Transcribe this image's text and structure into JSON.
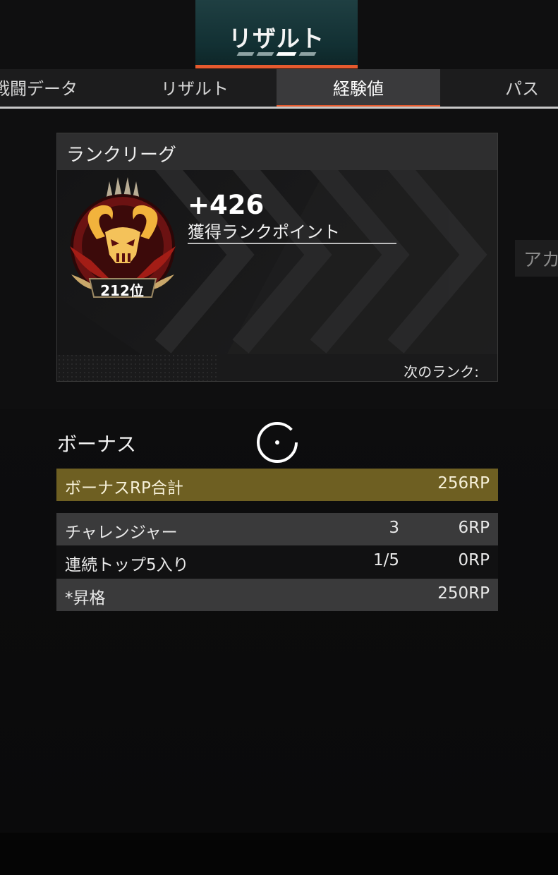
{
  "header": {
    "title": "リザルト"
  },
  "tabs": [
    {
      "label": "戦闘データ",
      "active": false
    },
    {
      "label": "リザルト",
      "active": false
    },
    {
      "label": "経験値",
      "active": true
    },
    {
      "label": "パス",
      "active": false
    }
  ],
  "rank_card": {
    "title": "ランクリーグ",
    "gain": "+426",
    "gain_label": "獲得ランクポイント",
    "placement": "212位",
    "next_rank_label": "次のランク:",
    "badge_icon": "apex-predator-badge-icon"
  },
  "side_tab": {
    "label": "アカ"
  },
  "bonus": {
    "title": "ボーナス",
    "total": {
      "label": "ボーナスRP合計",
      "points": "256RP"
    },
    "rows": [
      {
        "label": "チャレンジャー",
        "count": "3",
        "points": "6RP"
      },
      {
        "label": "連続トップ5入り",
        "count": "1/5",
        "points": "0RP"
      },
      {
        "label": "*昇格",
        "count": "",
        "points": "250RP"
      }
    ]
  },
  "colors": {
    "accent": "#e55a2e",
    "header_teal": "#123033",
    "bonus_total": "#6e5f22",
    "row_gray": "#3a3a3b"
  }
}
